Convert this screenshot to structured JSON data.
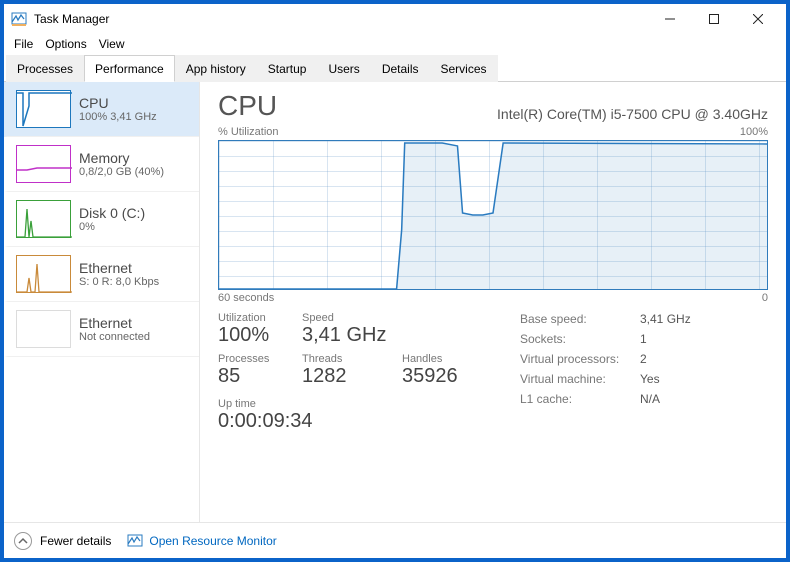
{
  "window": {
    "title": "Task Manager"
  },
  "menubar": [
    "File",
    "Options",
    "View"
  ],
  "tabs": [
    "Processes",
    "Performance",
    "App history",
    "Startup",
    "Users",
    "Details",
    "Services"
  ],
  "active_tab": "Performance",
  "sidebar": [
    {
      "title": "CPU",
      "sub": "100% 3,41 GHz",
      "color": "#1d77bd",
      "selected": true
    },
    {
      "title": "Memory",
      "sub": "0,8/2,0 GB (40%)",
      "color": "#c030c8"
    },
    {
      "title": "Disk 0 (C:)",
      "sub": "0%",
      "color": "#3aa03a"
    },
    {
      "title": "Ethernet",
      "sub": "S: 0  R: 8,0 Kbps",
      "color": "#c98a3a"
    },
    {
      "title": "Ethernet",
      "sub": "Not connected",
      "color": "#bcbcbc"
    }
  ],
  "main": {
    "heading": "CPU",
    "processor": "Intel(R) Core(TM) i5-7500 CPU @ 3.40GHz",
    "graph_top_left": "% Utilization",
    "graph_top_right": "100%",
    "graph_bottom_left": "60 seconds",
    "graph_bottom_right": "0",
    "stats": {
      "utilization_label": "Utilization",
      "utilization": "100%",
      "speed_label": "Speed",
      "speed": "3,41 GHz",
      "processes_label": "Processes",
      "processes": "85",
      "threads_label": "Threads",
      "threads": "1282",
      "handles_label": "Handles",
      "handles": "35926",
      "uptime_label": "Up time",
      "uptime": "0:00:09:34"
    },
    "details": [
      {
        "k": "Base speed:",
        "v": "3,41 GHz"
      },
      {
        "k": "Sockets:",
        "v": "1"
      },
      {
        "k": "Virtual processors:",
        "v": "2"
      },
      {
        "k": "Virtual machine:",
        "v": "Yes"
      },
      {
        "k": "L1 cache:",
        "v": "N/A"
      }
    ]
  },
  "footer": {
    "fewer": "Fewer details",
    "rmon": "Open Resource Monitor"
  },
  "chart_data": {
    "type": "line",
    "title": "CPU % Utilization",
    "xlabel": "60 seconds",
    "ylabel": "% Utilization",
    "ylim": [
      0,
      100
    ],
    "xlim": [
      60,
      0
    ],
    "x": [
      60,
      55,
      50,
      45,
      41,
      40.5,
      40,
      36,
      34,
      33.5,
      33,
      32,
      31,
      30,
      28,
      24,
      20,
      16,
      12,
      8,
      4,
      0
    ],
    "values": [
      0,
      0,
      0,
      0,
      0,
      40,
      100,
      100,
      98,
      55,
      50,
      50,
      50,
      55,
      100,
      100,
      100,
      100,
      100,
      98,
      100,
      100
    ]
  }
}
